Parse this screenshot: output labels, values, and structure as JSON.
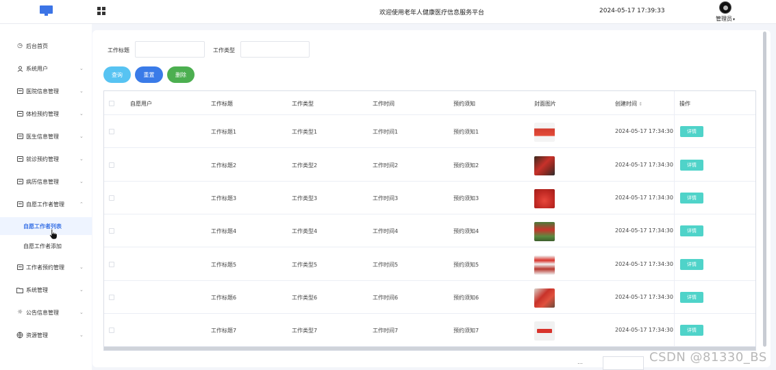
{
  "header": {
    "welcome_text": "欢迎使用老年人健康医疗信息服务平台",
    "datetime": "2024-05-17 17:39:33",
    "user_name": "管理员",
    "accent_color": "#3c74e6"
  },
  "sidebar": {
    "items": [
      {
        "label": "后台首页",
        "icon": "clock-icon"
      },
      {
        "label": "系统用户",
        "icon": "user-icon"
      },
      {
        "label": "医院信息管理",
        "icon": "list-box-icon"
      },
      {
        "label": "体检预约管理",
        "icon": "list-box-icon"
      },
      {
        "label": "医生信息管理",
        "icon": "list-box-icon"
      },
      {
        "label": "就诊预约管理",
        "icon": "list-box-icon"
      },
      {
        "label": "病历信息管理",
        "icon": "list-box-icon"
      },
      {
        "label": "自愿工作者管理",
        "icon": "list-box-icon"
      },
      {
        "label": "工作者预约管理",
        "icon": "list-box-icon"
      },
      {
        "label": "系统管理",
        "icon": "folder-icon"
      },
      {
        "label": "公告信息管理",
        "icon": "sun-icon"
      },
      {
        "label": "资源管理",
        "icon": "globe-icon"
      }
    ],
    "sub_items": [
      {
        "label": "自愿工作者列表",
        "active": true
      },
      {
        "label": "自愿工作者添加",
        "active": false
      }
    ]
  },
  "search": {
    "title_label": "工作标题",
    "type_label": "工作类型",
    "title_value": "",
    "type_value": ""
  },
  "actions": {
    "query": "查询",
    "reset": "重置",
    "delete": "删除",
    "query_color": "#57c3f2",
    "reset_color": "#3a7be8",
    "delete_color": "#4caf50"
  },
  "table": {
    "headers": [
      "自愿用户",
      "工作标题",
      "工作类型",
      "工作时间",
      "预约须知",
      "封面图片",
      "创建时间",
      "操作"
    ],
    "detail_label": "详情",
    "rows": [
      {
        "user": "",
        "title": "工作标题1",
        "type": "工作类型1",
        "time": "工作时间1",
        "notice": "预约须知1",
        "created": "2024-05-17 17:34:30"
      },
      {
        "user": "",
        "title": "工作标题2",
        "type": "工作类型2",
        "time": "工作时间2",
        "notice": "预约须知2",
        "created": "2024-05-17 17:34:30"
      },
      {
        "user": "",
        "title": "工作标题3",
        "type": "工作类型3",
        "time": "工作时间3",
        "notice": "预约须知3",
        "created": "2024-05-17 17:34:30"
      },
      {
        "user": "",
        "title": "工作标题4",
        "type": "工作类型4",
        "time": "工作时间4",
        "notice": "预约须知4",
        "created": "2024-05-17 17:34:30"
      },
      {
        "user": "",
        "title": "工作标题5",
        "type": "工作类型5",
        "time": "工作时间5",
        "notice": "预约须知5",
        "created": "2024-05-17 17:34:30"
      },
      {
        "user": "",
        "title": "工作标题6",
        "type": "工作类型6",
        "time": "工作时间6",
        "notice": "预约须知6",
        "created": "2024-05-17 17:34:30"
      },
      {
        "user": "",
        "title": "工作标题7",
        "type": "工作类型7",
        "time": "工作时间7",
        "notice": "预约须知7",
        "created": "2024-05-17 17:34:30"
      }
    ]
  },
  "watermark": "CSDN @81330_BS"
}
